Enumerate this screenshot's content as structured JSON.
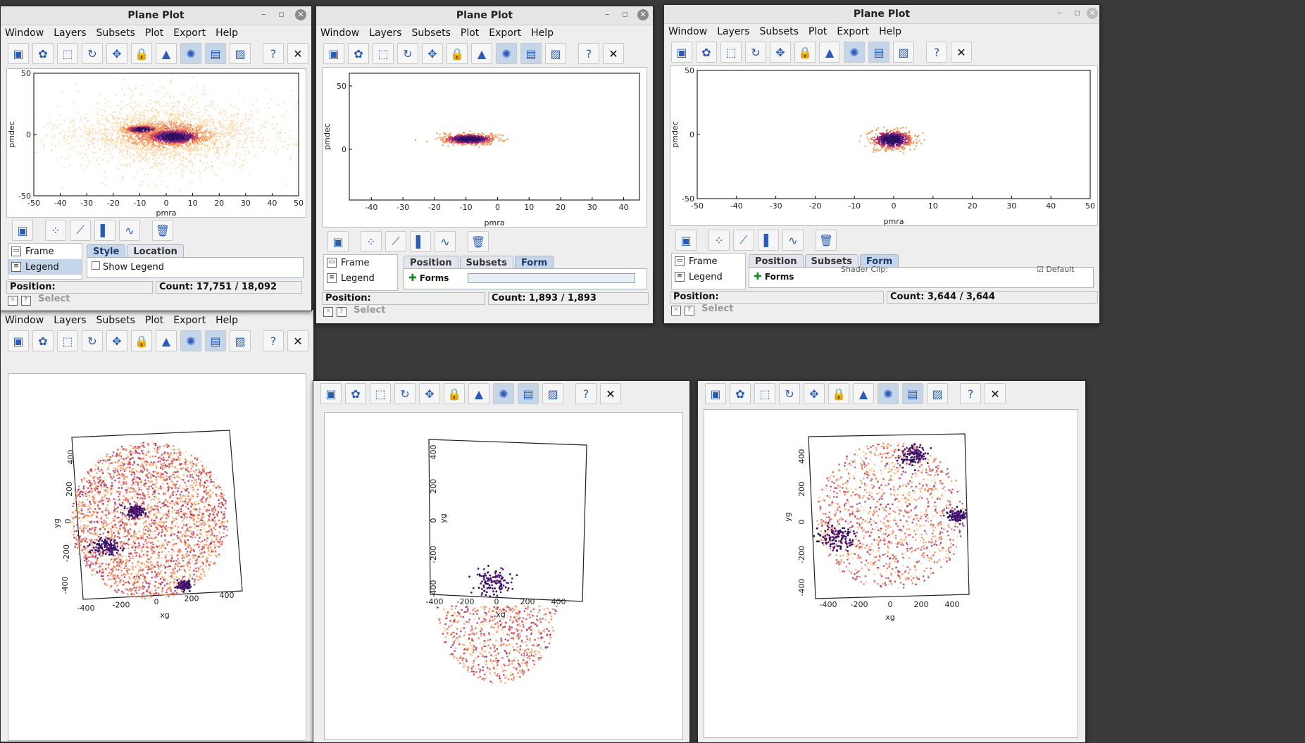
{
  "window_title": "Plane Plot",
  "menu": [
    "Window",
    "Layers",
    "Subsets",
    "Plot",
    "Export",
    "Help"
  ],
  "layer_panel": {
    "frame": "Frame",
    "legend": "Legend",
    "tabs_style": [
      "Style",
      "Location"
    ],
    "tabs_form": [
      "Position",
      "Subsets",
      "Form"
    ],
    "show_legend": "Show Legend",
    "forms_button": "Forms",
    "shader_clip": "Shader Clip:",
    "default": "Default"
  },
  "status": {
    "position_label": "Position:",
    "select_label": "Select"
  },
  "windows": [
    {
      "title": "Plane Plot",
      "count": "Count: 17,751 / 18,092"
    },
    {
      "title": "Plane Plot",
      "count": "Count: 1,893 / 1,893"
    },
    {
      "title": "Plane Plot",
      "count": "Count: 3,644 / 3,644"
    }
  ],
  "colors": {
    "shade_dark": "#2a1060",
    "shade_mid": "#c0305a",
    "shade_light": "#f5a060",
    "select": "#c5d5ea"
  },
  "chart_data": [
    {
      "type": "scatter",
      "xlabel": "pmra",
      "ylabel": "pmdec",
      "xlim": [
        -50,
        50
      ],
      "ylim": [
        -50,
        50
      ],
      "xticks": [
        -50,
        -40,
        -30,
        -20,
        -10,
        0,
        10,
        20,
        30,
        40,
        50
      ],
      "yticks": [
        -50,
        0,
        50
      ],
      "spread": {
        "sx": 14,
        "sy": 9,
        "n": 2600
      },
      "clusters": [
        {
          "x": -9,
          "y": 4,
          "sx": 3,
          "sy": 1.5
        },
        {
          "x": 3,
          "y": -2,
          "sx": 5,
          "sy": 3
        }
      ]
    },
    {
      "type": "scatter",
      "xlabel": "pmra",
      "ylabel": "pmdec",
      "xlim": [
        -47,
        45
      ],
      "ylim": [
        -40,
        60
      ],
      "xticks": [
        -40,
        -30,
        -20,
        -10,
        0,
        10,
        20,
        30,
        40
      ],
      "yticks": [
        0,
        50
      ],
      "clusters": [
        {
          "x": -9,
          "y": 8,
          "sx": 4,
          "sy": 2
        }
      ]
    },
    {
      "type": "scatter",
      "xlabel": "pmra",
      "ylabel": "pmdec",
      "xlim": [
        -50,
        50
      ],
      "ylim": [
        -50,
        50
      ],
      "xticks": [
        -50,
        -40,
        -30,
        -20,
        -10,
        0,
        10,
        20,
        30,
        40,
        50
      ],
      "yticks": [
        -50,
        0,
        50
      ],
      "clusters": [
        {
          "x": -0.5,
          "y": -4,
          "sx": 2.5,
          "sy": 3.5
        }
      ]
    },
    {
      "type": "scatter",
      "xlabel": "xg",
      "ylabel": "yg",
      "xticks": [
        -400,
        -200,
        0,
        200,
        400
      ],
      "yticks": [
        -400,
        -200,
        0,
        200,
        400
      ]
    },
    {
      "type": "scatter",
      "xlabel": "xg",
      "ylabel": "yg",
      "xticks": [
        -400,
        -200,
        0,
        200,
        400
      ],
      "yticks": [
        -400,
        -200,
        0,
        200,
        400
      ]
    },
    {
      "type": "scatter",
      "xlabel": "xg",
      "ylabel": "yg",
      "xticks": [
        -400,
        -200,
        0,
        200,
        400
      ],
      "yticks": [
        -400,
        -200,
        0,
        200,
        400
      ]
    }
  ]
}
